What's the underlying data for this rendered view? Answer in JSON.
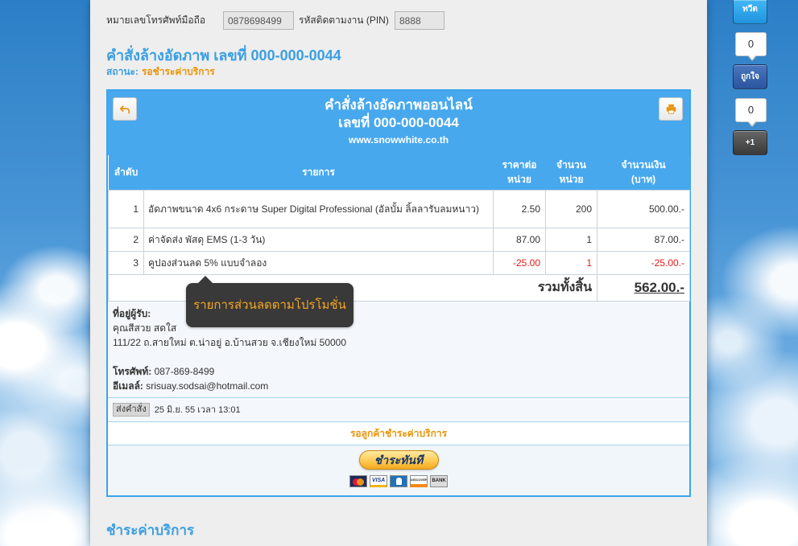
{
  "colors": {
    "accent": "#3a9fe2",
    "orange": "#e8960c",
    "box-border": "#3aa4ec",
    "head-bg": "#47a8ee",
    "negative": "#e21b1b",
    "tooltip-text": "#f5a623"
  },
  "lookup": {
    "phone_label": "หมายเลขโทรศัพท์มือถือ",
    "phone_value": "0878698499",
    "pin_label": "รหัสติดตามงาน (PIN)",
    "pin_value": "8888"
  },
  "order": {
    "heading": "คำสั่งล้างอัดภาพ เลขที่ 000-000-0044",
    "status_label": "สถานะ:",
    "status_value": "รอชำระค่าบริการ"
  },
  "invoice": {
    "back_icon": "back-arrow-icon",
    "print_icon": "printer-icon",
    "title": "คำสั่งล้างอัดภาพออนไลน์",
    "number": "เลขที่ 000-000-0044",
    "website": "www.snowwhite.co.th",
    "columns": {
      "no": "ลำดับ",
      "item": "รายการ",
      "unit_price_1": "ราคาต่อ",
      "unit_price_2": "หน่วย",
      "qty_1": "จำนวน",
      "qty_2": "หน่วย",
      "amount_1": "จำนวนเงิน",
      "amount_2": "(บาท)"
    },
    "items": [
      {
        "no": "1",
        "description": "อัดภาพขนาด 4x6 กระดาษ Super Digital Professional (อัลบั้ม ลิ้ลลารับลมหนาว)",
        "unit_price": "2.50",
        "qty": "200",
        "amount": "500.00.-"
      },
      {
        "no": "2",
        "description": "ค่าจัดส่ง พัสดุ EMS (1-3 วัน)",
        "unit_price": "87.00",
        "qty": "1",
        "amount": "87.00.-"
      },
      {
        "no": "3",
        "description": "คูปองส่วนลด 5% แบบจำลอง",
        "unit_price": "-25.00",
        "qty": "1",
        "amount": "-25.00.-"
      }
    ],
    "total_label": "รวมทั้งสิ้น",
    "total_value": "562.00.-",
    "discount_tooltip": "รายการส่วนลดตามโปรโมชั่น"
  },
  "recipient": {
    "address_label": "ที่อยู่ผู้รับ:",
    "name": "คุณสีสวย สดใส",
    "address": "111/22 ถ.สายใหม่ ต.น่าอยู่ อ.บ้านสวย จ.เชียงใหม่ 50000",
    "phone_label": "โทรศัพท์:",
    "phone": "087-869-8499",
    "email_label": "อีเมลล์:",
    "email": "srisuay.sodsai@hotmail.com"
  },
  "sent": {
    "badge": "ส่งคำสั่ง",
    "datetime": "25 มิ.ย. 55 เวลา 13:01"
  },
  "payment_status": "รอลูกค้าชำระค่าบริการ",
  "pay": {
    "button_label": "ชำระทันที",
    "cards": [
      {
        "icon": "mastercard-icon"
      },
      {
        "icon": "visa-icon",
        "label": "VISA"
      },
      {
        "icon": "amex-icon"
      },
      {
        "icon": "discover-icon",
        "label": "DISCOVER"
      },
      {
        "icon": "bank-icon",
        "label": "BANK"
      }
    ]
  },
  "payment_section_heading": "ชำระค่าบริการ",
  "social": {
    "tweet_label": "ทวีต",
    "tweet_count": "0",
    "like_label": "ถูกใจ",
    "like_count": "0",
    "plusone_label": "+1"
  }
}
